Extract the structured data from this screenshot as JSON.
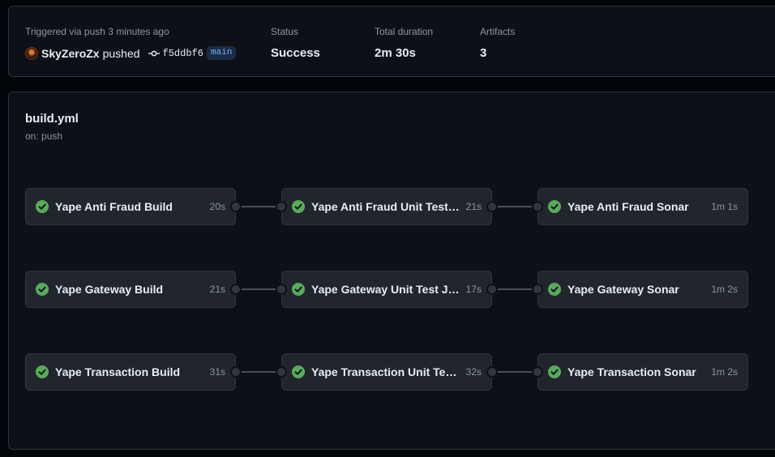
{
  "summary": {
    "trigger_label": "Triggered via push 3 minutes ago",
    "actor": "SkyZeroZx",
    "action": "pushed",
    "commit_sha": "f5ddbf6",
    "branch": "main",
    "status_label": "Status",
    "status_value": "Success",
    "duration_label": "Total duration",
    "duration_value": "2m 30s",
    "artifacts_label": "Artifacts",
    "artifacts_value": "3"
  },
  "workflow": {
    "title": "build.yml",
    "trigger": "on: push",
    "status_color": "#57ab5a",
    "rows": [
      [
        {
          "name": "Yape Anti Fraud Build",
          "duration": "20s"
        },
        {
          "name": "Yape Anti Fraud Unit Test Jest",
          "duration": "21s"
        },
        {
          "name": "Yape Anti Fraud Sonar",
          "duration": "1m 1s"
        }
      ],
      [
        {
          "name": "Yape Gateway Build",
          "duration": "21s"
        },
        {
          "name": "Yape Gateway Unit Test Jest",
          "duration": "17s"
        },
        {
          "name": "Yape Gateway Sonar",
          "duration": "1m 2s"
        }
      ],
      [
        {
          "name": "Yape Transaction Build",
          "duration": "31s"
        },
        {
          "name": "Yape Transaction Unit Test J...",
          "duration": "32s"
        },
        {
          "name": "Yape Transaction Sonar",
          "duration": "1m 2s"
        }
      ]
    ]
  }
}
